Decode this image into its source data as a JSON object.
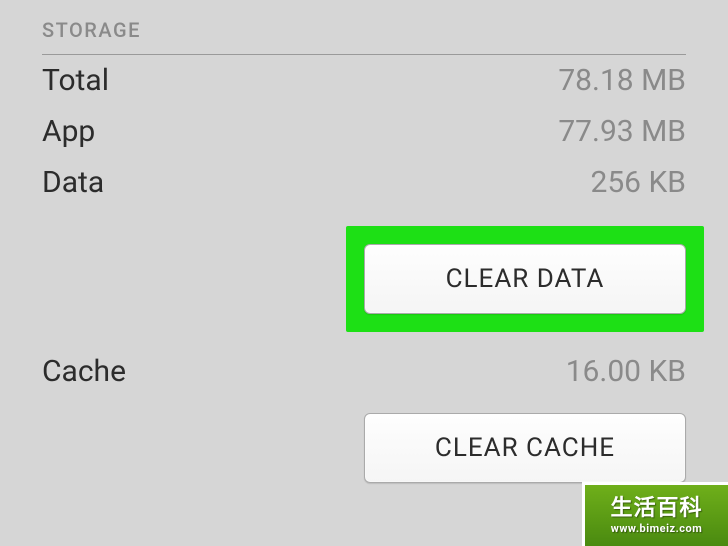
{
  "section": {
    "title": "STORAGE",
    "rows": [
      {
        "label": "Total",
        "value": "78.18 MB"
      },
      {
        "label": "App",
        "value": "77.93 MB"
      },
      {
        "label": "Data",
        "value": "256 KB"
      }
    ],
    "cache_row": {
      "label": "Cache",
      "value": "16.00 KB"
    },
    "buttons": {
      "clear_data": "CLEAR DATA",
      "clear_cache": "CLEAR CACHE"
    }
  },
  "watermark": {
    "line1": "生活百科",
    "line2": "www.bimeiz.com"
  }
}
